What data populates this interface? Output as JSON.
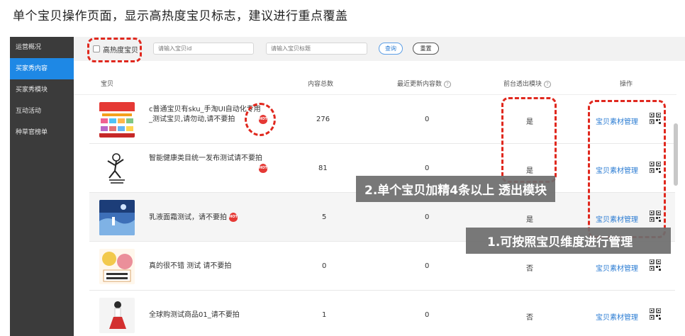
{
  "caption": "单个宝贝操作页面，显示高热度宝贝标志，建议进行重点覆盖",
  "sidebar": {
    "items": [
      {
        "label": "运营概况",
        "active": false
      },
      {
        "label": "买家秀内容",
        "active": true
      },
      {
        "label": "买家秀模块",
        "active": false
      },
      {
        "label": "互动活动",
        "active": false
      },
      {
        "label": "种草官榜单",
        "active": false
      }
    ]
  },
  "filters": {
    "hot_label": "高热度宝贝",
    "id_placeholder": "请输入宝贝id",
    "title_placeholder": "请输入宝贝标题",
    "query_label": "查询",
    "reset_label": "重置"
  },
  "table": {
    "headers": {
      "item": "宝贝",
      "total": "内容总数",
      "recent": "最近更新内容数",
      "front": "前台透出模块",
      "ops": "操作"
    },
    "help_glyph": "?",
    "hot_badge": "HOT",
    "manage_label": "宝贝素材管理",
    "rows": [
      {
        "title": "c普通宝贝有sku_手淘UI自动化专用_测试宝贝,请勿动,请不要拍",
        "total": "276",
        "recent": "0",
        "front": "是",
        "hot": true
      },
      {
        "title": "智能健康类目统一发布测试请不要拍",
        "total": "81",
        "recent": "0",
        "front": "是",
        "hot": true
      },
      {
        "title": "乳液面霜测试，请不要拍",
        "total": "5",
        "recent": "0",
        "front": "是",
        "hot": true
      },
      {
        "title": "真的很不错 测试 请不要拍",
        "total": "0",
        "recent": "0",
        "front": "否",
        "hot": false
      },
      {
        "title": "全球购测试商品01_请不要拍",
        "total": "1",
        "recent": "0",
        "front": "否",
        "hot": false
      }
    ]
  },
  "annotations": {
    "label_one": "1.可按照宝贝维度进行管理",
    "label_two": "2.单个宝贝加精4条以上 透出模块",
    "color": "#e0281e"
  }
}
